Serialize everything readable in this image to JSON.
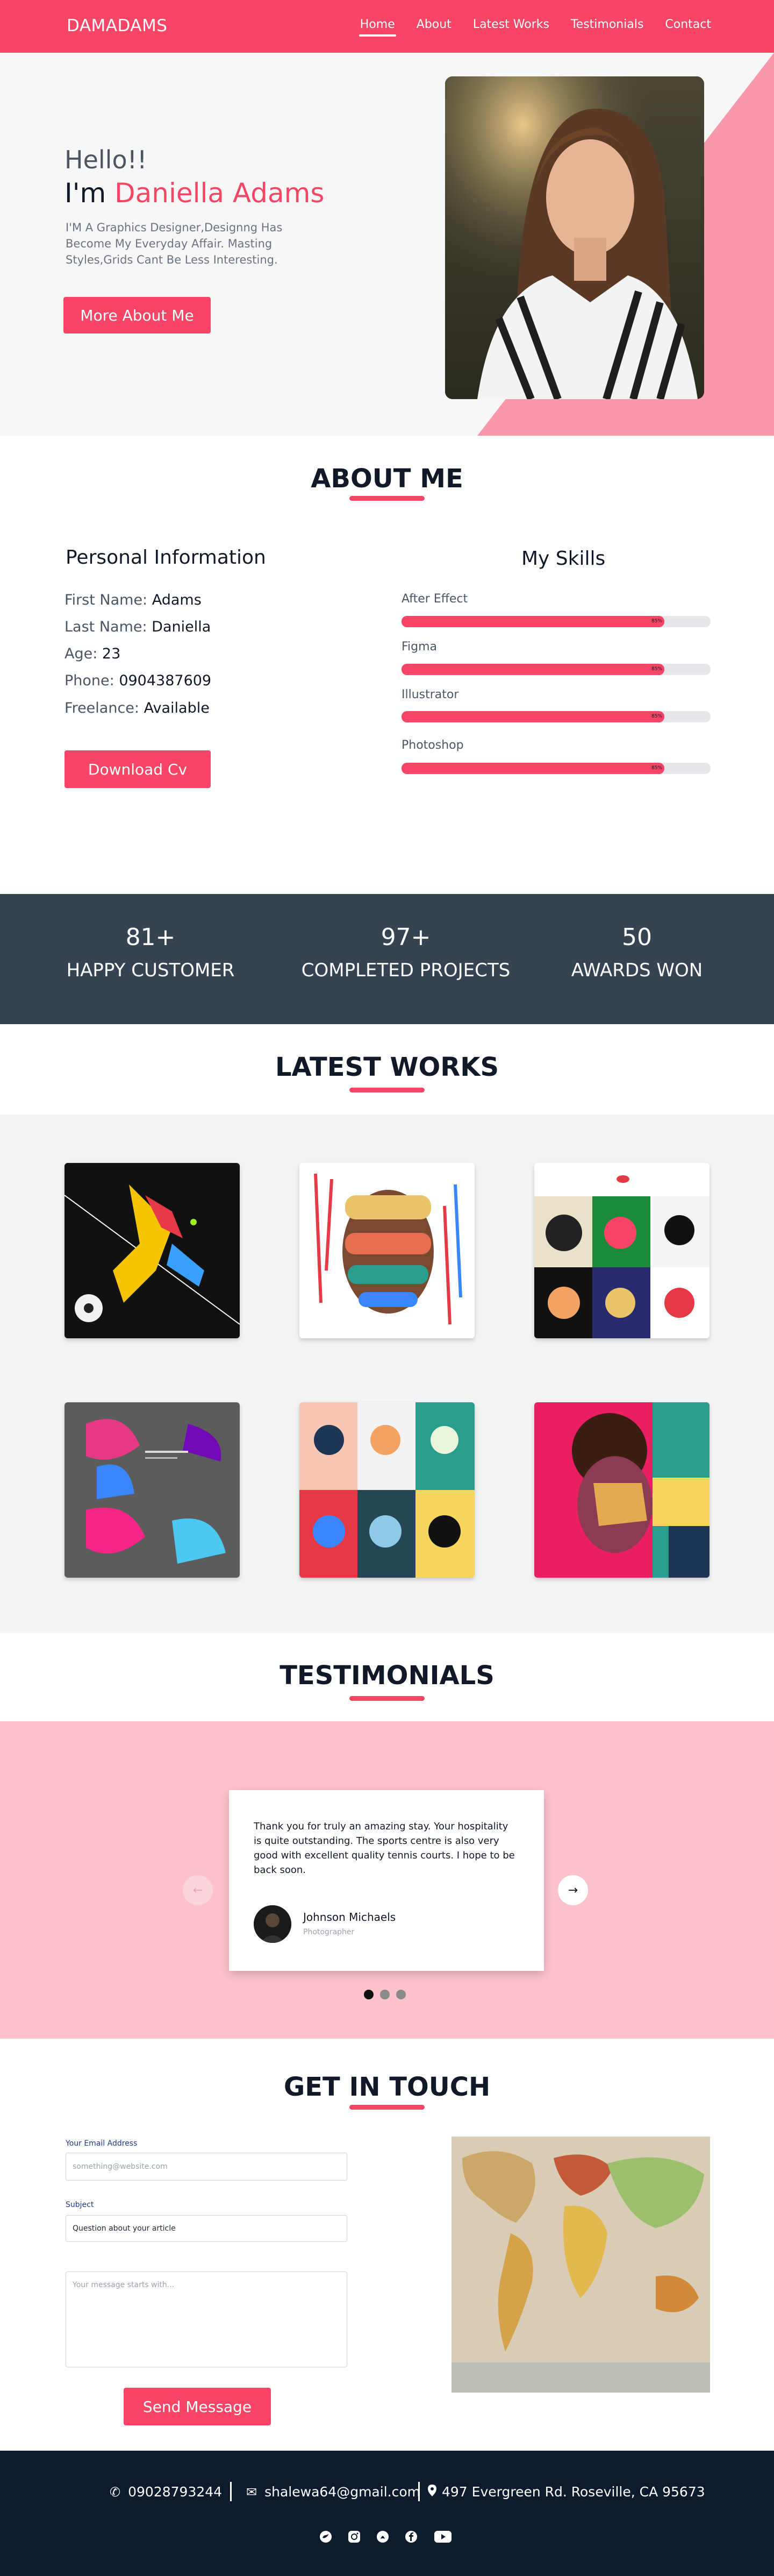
{
  "header": {
    "logo": "DAMADAMS",
    "nav": [
      "Home",
      "About",
      "Latest Works",
      "Testimonials",
      "Contact"
    ],
    "active": "Home"
  },
  "hero": {
    "greeting": "Hello!!",
    "im": "I'm",
    "name": "Daniella Adams",
    "bio": "I'M A Graphics Designer,Designng Has Become My Everyday Affair. Masting Styles,Grids Cant Be Less Interesting.",
    "button": "More About Me"
  },
  "about": {
    "title": "ABOUT ME",
    "personal_title": "Personal Information",
    "fields": [
      {
        "label": "First Name:",
        "value": "Adams"
      },
      {
        "label": "Last Name:",
        "value": "Daniella"
      },
      {
        "label": "Age:",
        "value": "23"
      },
      {
        "label": "Phone:",
        "value": "0904387609"
      },
      {
        "label": "Freelance:",
        "value": "Available"
      }
    ],
    "button": "Download Cv",
    "skills_title": "My Skills",
    "skills": [
      {
        "name": "After Effect",
        "percent": 85,
        "pct_label": "85%"
      },
      {
        "name": "Figma",
        "percent": 85,
        "pct_label": "85%"
      },
      {
        "name": "Illustrator",
        "percent": 85,
        "pct_label": "85%"
      },
      {
        "name": "Photoshop",
        "percent": 85,
        "pct_label": "85%"
      }
    ]
  },
  "stats": [
    {
      "number": "81+",
      "label": "HAPPY CUSTOMER"
    },
    {
      "number": "97+",
      "label": "COMPLETED PROJECTS"
    },
    {
      "number": "50",
      "label": "AWARDS WON"
    }
  ],
  "works": {
    "title": "LATEST WORKS"
  },
  "testimonials": {
    "title": "TESTIMONIALS",
    "quote": "Thank you for truly an amazing stay. Your hospitality is quite outstanding. The sports centre is also very good with  excellent quality tennis courts. I hope to be back soon.",
    "author": "Johnson Michaels",
    "role": "Photographer",
    "prev_icon": "arrow-left-icon",
    "next_icon": "arrow-right-icon"
  },
  "contact": {
    "title": "GET IN TOUCH",
    "email_label": "Your Email Address",
    "email_placeholder": "something@website.com",
    "subject_label": "Subject",
    "subject_value": "Question about your article",
    "message_placeholder": "Your message starts with...",
    "button": "Send Message"
  },
  "footer": {
    "phone": "09028793244",
    "email": "shalewa64@gmail.com",
    "address": "497 Evergreen Rd. Roseville, CA 95673",
    "social_icons": [
      "twitter-icon",
      "instagram-icon",
      "snapchat-icon",
      "facebook-icon",
      "youtube-icon"
    ]
  },
  "colors": {
    "accent": "#f94565",
    "stats_bg": "#364352",
    "footer_bg": "#0e1a2d",
    "testimonial_bg": "#fdc2cc"
  }
}
